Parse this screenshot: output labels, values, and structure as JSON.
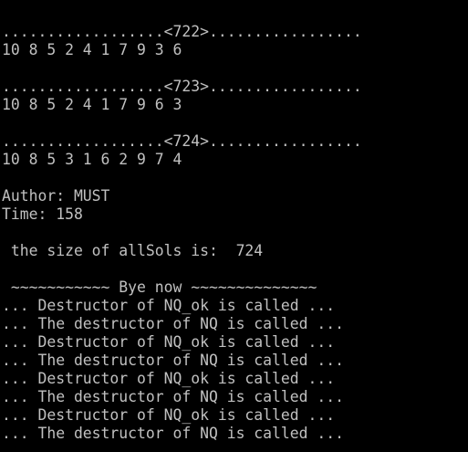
{
  "console": {
    "text_color": "#c0c0c0",
    "background_color": "#000000",
    "lines": [
      "..................<722>.................",
      "10 8 5 2 4 1 7 9 3 6",
      "",
      "..................<723>.................",
      "10 8 5 2 4 1 7 9 6 3",
      "",
      "..................<724>.................",
      "10 8 5 3 1 6 2 9 7 4",
      "",
      "Author: MUST",
      "Time: 158",
      "",
      " the size of allSols is:  724",
      "",
      " ~~~~~~~~~~~ Bye now ~~~~~~~~~~~~~~",
      "... Destructor of NQ_ok is called ...",
      "... The destructor of NQ is called ...",
      "... Destructor of NQ_ok is called ...",
      "... The destructor of NQ is called ...",
      "... Destructor of NQ_ok is called ...",
      "... The destructor of NQ is called ...",
      "... Destructor of NQ_ok is called ...",
      "... The destructor of NQ is called ..."
    ]
  }
}
